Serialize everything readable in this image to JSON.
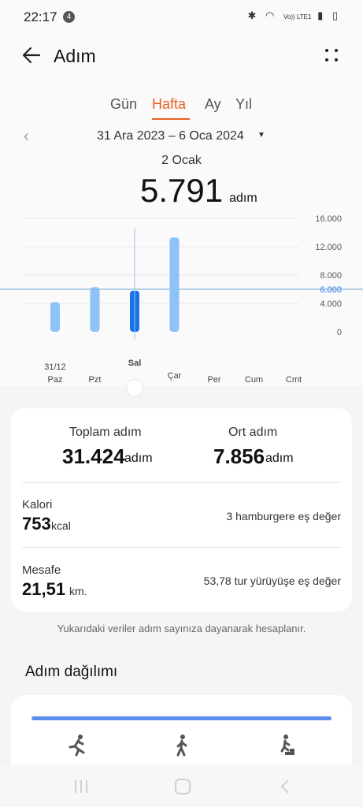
{
  "status": {
    "time": "22:17",
    "notification_count": "4",
    "network": "Vo)) LTE1"
  },
  "header": {
    "title": "Adım"
  },
  "tabs": [
    {
      "label": "Gün"
    },
    {
      "label": "Hafta"
    },
    {
      "label": "Ay"
    },
    {
      "label": "Yıl"
    }
  ],
  "range": {
    "text": "31 Ara 2023 – 6 Oca 2024"
  },
  "selection": {
    "date": "2 Ocak",
    "value": "5.791",
    "unit": "adım"
  },
  "chart_data": {
    "type": "bar",
    "categories": [
      "Paz",
      "Pzt",
      "Sal",
      "Çar",
      "Per",
      "Cum",
      "Cmt"
    ],
    "category_date_labels": {
      "Paz": "31/12"
    },
    "values": [
      4200,
      6300,
      5791,
      13300,
      0,
      0,
      0
    ],
    "selected_index": 2,
    "goal": 6000,
    "ylim": [
      0,
      16000
    ],
    "ytick_labels": [
      "16.000",
      "12.000",
      "8.000",
      "6.000",
      "4.000",
      "0"
    ],
    "bar_color": "#8fc3f7",
    "selected_color": "#1a73e8"
  },
  "summary": {
    "total_label": "Toplam adım",
    "total_value": "31.424",
    "total_unit": "adım",
    "avg_label": "Ort adım",
    "avg_value": "7.856",
    "avg_unit": "adım",
    "calorie_label": "Kalori",
    "calorie_value": "753",
    "calorie_unit": "kcal",
    "calorie_equiv": "3 hamburgere eş değer",
    "distance_label": "Mesafe",
    "distance_value": "21,51",
    "distance_unit": "km.",
    "distance_equiv": "53,78 tur yürüyüşe eş değer"
  },
  "footnote": "Yukarıdaki veriler adım sayınıza dayanarak hesaplanır.",
  "distribution": {
    "title": "Adım dağılımı"
  }
}
